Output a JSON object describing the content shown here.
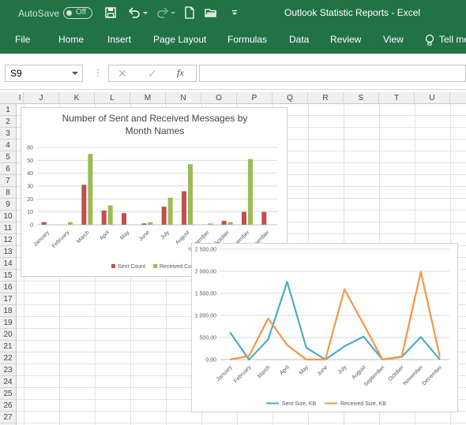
{
  "app": {
    "autosave_label": "AutoSave",
    "autosave_state": "Off",
    "title": "Outlook Statistic Reports  -  Excel"
  },
  "ribbon": {
    "tabs": [
      "File",
      "Home",
      "Insert",
      "Page Layout",
      "Formulas",
      "Data",
      "Review",
      "View",
      "Tell me"
    ]
  },
  "formula_bar": {
    "name_box": "S9",
    "fx_label": "fx",
    "formula": ""
  },
  "grid": {
    "columns": [
      "I",
      "J",
      "K",
      "L",
      "M",
      "N",
      "O",
      "P",
      "Q",
      "R",
      "S",
      "T",
      "U"
    ],
    "rows": [
      "1",
      "2",
      "3",
      "4",
      "5",
      "6",
      "7",
      "8",
      "9",
      "10",
      "11",
      "12",
      "13",
      "14",
      "15",
      "16",
      "17",
      "18",
      "19",
      "20",
      "21",
      "22",
      "23",
      "24",
      "25",
      "26",
      "27"
    ]
  },
  "colors": {
    "excel_green": "#217346",
    "sent_bar": "#c0504d",
    "received_bar": "#9bbb59",
    "sent_line": "#4bacc6",
    "received_line": "#f79646"
  },
  "chart_data": [
    {
      "type": "bar",
      "title": "Number of Sent and Received Messages by Month Names",
      "categories": [
        "January",
        "February",
        "March",
        "April",
        "May",
        "June",
        "July",
        "August",
        "September",
        "October",
        "November",
        "December"
      ],
      "series": [
        {
          "name": "Sent Count",
          "values": [
            2,
            0,
            31,
            11,
            9,
            1,
            14,
            26,
            0,
            3,
            10,
            10
          ]
        },
        {
          "name": "Received Count",
          "values": [
            0,
            2,
            55,
            15,
            0,
            2,
            21,
            47,
            1,
            2,
            51,
            0
          ]
        }
      ],
      "ylim": [
        0,
        60
      ],
      "yticks": [
        "0",
        "10",
        "20",
        "30",
        "40",
        "50",
        "60"
      ],
      "legend": "bottom",
      "grid": true
    },
    {
      "type": "line",
      "title": "",
      "categories": [
        "January",
        "February",
        "March",
        "April",
        "May",
        "June",
        "July",
        "August",
        "September",
        "October",
        "November",
        "December"
      ],
      "series": [
        {
          "name": "Sent Size, KB",
          "values": [
            620,
            0,
            450,
            1760,
            270,
            0,
            300,
            520,
            0,
            60,
            510,
            0
          ]
        },
        {
          "name": "Received Size, KB",
          "values": [
            0,
            80,
            930,
            330,
            0,
            0,
            1590,
            800,
            0,
            70,
            1990,
            60
          ]
        }
      ],
      "ylim": [
        0,
        2500
      ],
      "yticks": [
        "0,00",
        "500,00",
        "1 000,00",
        "1 500,00",
        "2 000,00",
        "2 500,00"
      ],
      "legend": "bottom",
      "grid": true
    }
  ]
}
